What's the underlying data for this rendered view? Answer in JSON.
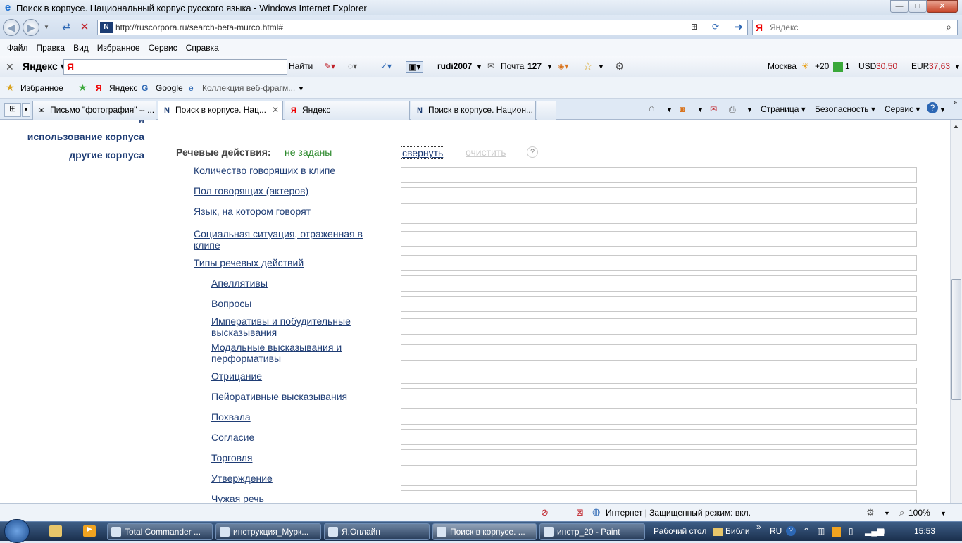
{
  "window": {
    "title": "Поиск в корпусе. Национальный корпус русского языка - Windows Internet Explorer",
    "min": "—",
    "max": "□",
    "close": "✕"
  },
  "address": {
    "url": "http://ruscorpora.ru/search-beta-murco.html#",
    "search_placeholder": "Яндекс"
  },
  "menu": [
    "Файл",
    "Правка",
    "Вид",
    "Избранное",
    "Сервис",
    "Справка"
  ],
  "ytoolbar": {
    "logo": "Яндекс",
    "find": "Найти",
    "user": "rudi2007",
    "mail_label": "Почта",
    "mail_count": "127",
    "city": "Москва",
    "temp": "+20",
    "traffic": "1",
    "usd_label": "USD",
    "usd": "30,50",
    "eur_label": "EUR",
    "eur": "37,63"
  },
  "favorites": {
    "fav_label": "Избранное",
    "items": [
      "Яндекс",
      "Google",
      "Коллекция веб-фрагм..."
    ]
  },
  "tabs": [
    {
      "label": "Письмо \"фотография\" -- ...",
      "active": false
    },
    {
      "label": "Поиск в корпусе. Нац...",
      "active": true
    },
    {
      "label": "Яндекс",
      "active": false
    },
    {
      "label": "Поиск в корпусе. Национ...",
      "active": false
    }
  ],
  "commands": [
    "Страница",
    "Безопасность",
    "Сервис"
  ],
  "sidenav": [
    "использование корпуса",
    "другие корпуса"
  ],
  "section": {
    "title": "Речевые действия:",
    "value": "не заданы",
    "collapse": "свернуть",
    "clear": "очистить",
    "help": "?"
  },
  "rows": [
    {
      "label": "Количество говорящих в клипе",
      "indent": 1
    },
    {
      "label": "Пол говорящих (актеров)",
      "indent": 1
    },
    {
      "label": "Язык, на котором говорят",
      "indent": 1
    },
    {
      "label": "Социальная ситуация, отраженная в клипе",
      "indent": 1
    },
    {
      "label": "Типы речевых действий",
      "indent": 1
    },
    {
      "label": "Апеллятивы",
      "indent": 2
    },
    {
      "label": "Вопросы",
      "indent": 2
    },
    {
      "label": "Императивы и побудительные высказывания",
      "indent": 2
    },
    {
      "label": "Модальные высказывания и перформативы",
      "indent": 2
    },
    {
      "label": "Отрицание",
      "indent": 2
    },
    {
      "label": "Пейоративные высказывания",
      "indent": 2
    },
    {
      "label": "Похвала",
      "indent": 2
    },
    {
      "label": "Согласие",
      "indent": 2
    },
    {
      "label": "Торговля",
      "indent": 2
    },
    {
      "label": "Утверждение",
      "indent": 2
    },
    {
      "label": "Чужая речь",
      "indent": 2
    }
  ],
  "status": {
    "zone": "Интернет | Защищенный режим: вкл.",
    "zoom": "100%"
  },
  "taskbar": {
    "items": [
      {
        "label": "Total Commander ...",
        "active": false
      },
      {
        "label": "инструкция_Мурк...",
        "active": false
      },
      {
        "label": "Я.Онлайн",
        "active": false
      },
      {
        "label": "Поиск в корпусе. ...",
        "active": true
      },
      {
        "label": "инстр_20 - Paint",
        "active": false
      }
    ],
    "desktop": "Рабочий стол",
    "libs": "Библи",
    "lang": "RU",
    "time": "15:53"
  }
}
